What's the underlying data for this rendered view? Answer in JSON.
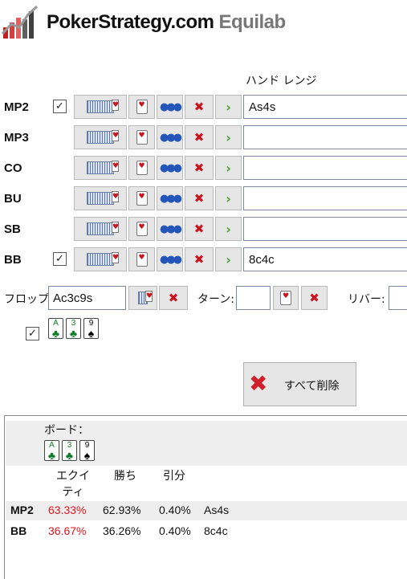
{
  "app": {
    "brand": "PokerStrategy.com",
    "product": "Equilab"
  },
  "range_header": "ハンド レンジ",
  "players": [
    {
      "name": "MP2",
      "checked": true,
      "hand": "As4s"
    },
    {
      "name": "MP3",
      "checked": false,
      "hand": ""
    },
    {
      "name": "CO",
      "checked": false,
      "hand": ""
    },
    {
      "name": "BU",
      "checked": false,
      "hand": ""
    },
    {
      "name": "SB",
      "checked": false,
      "hand": ""
    },
    {
      "name": "BB",
      "checked": true,
      "hand": "8c4c"
    }
  ],
  "board_inputs": {
    "flop_label": "フロップ:",
    "flop_value": "Ac3c9s",
    "turn_label": "ターン:",
    "turn_value": "",
    "river_label": "リバー:",
    "river_value": ""
  },
  "board_cards": [
    {
      "rank": "A",
      "suit": "♣",
      "color": "club"
    },
    {
      "rank": "3",
      "suit": "♣",
      "color": "club"
    },
    {
      "rank": "9",
      "suit": "♠",
      "color": "spade"
    }
  ],
  "delete_all_label": "すべて削除",
  "results": {
    "board_label": "ボード：",
    "columns": {
      "equity": "エクイ\nティ",
      "win": "勝ち",
      "tie": "引分"
    },
    "rows": [
      {
        "player": "MP2",
        "equity": "63.33%",
        "win": "62.93%",
        "tie": "0.40%",
        "hand": "As4s"
      },
      {
        "player": "BB",
        "equity": "36.67%",
        "win": "36.26%",
        "tie": "0.40%",
        "hand": "8c4c"
      }
    ]
  },
  "colors": {
    "equity_text": "#e0141e",
    "delete_icon": "#c8141e",
    "arrow_icon": "#46a02a"
  }
}
